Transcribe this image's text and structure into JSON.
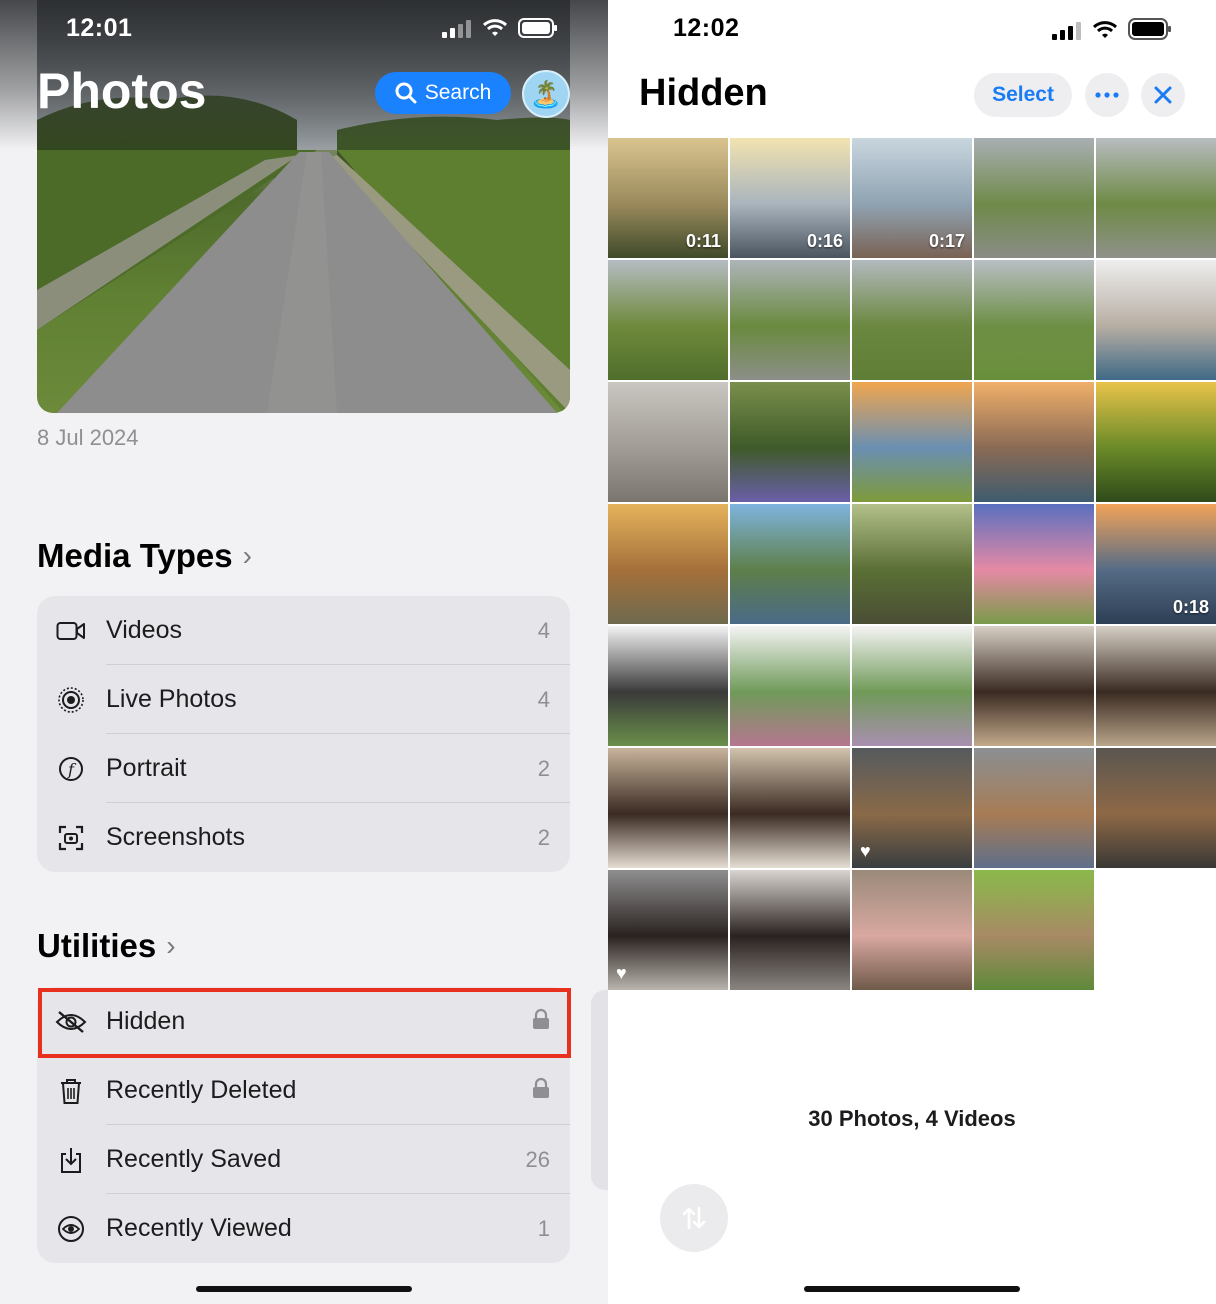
{
  "left": {
    "status_time": "12:01",
    "title": "Photos",
    "search_label": "Search",
    "avatar_emoji": "🏝️",
    "hero_date": "8 Jul 2024",
    "media_types": {
      "title": "Media Types",
      "items": [
        {
          "label": "Videos",
          "value": "4",
          "icon": "video-icon"
        },
        {
          "label": "Live Photos",
          "value": "4",
          "icon": "live-photos-icon"
        },
        {
          "label": "Portrait",
          "value": "2",
          "icon": "portrait-icon"
        },
        {
          "label": "Screenshots",
          "value": "2",
          "icon": "screenshot-icon"
        }
      ]
    },
    "utilities": {
      "title": "Utilities",
      "items": [
        {
          "label": "Hidden",
          "value": "",
          "icon": "hidden-eye-icon",
          "locked": true
        },
        {
          "label": "Recently Deleted",
          "value": "",
          "icon": "trash-icon",
          "locked": true
        },
        {
          "label": "Recently Saved",
          "value": "26",
          "icon": "download-tray-icon"
        },
        {
          "label": "Recently Viewed",
          "value": "1",
          "icon": "eye-icon"
        }
      ]
    }
  },
  "right": {
    "status_time": "12:02",
    "title": "Hidden",
    "select_label": "Select",
    "more_icon": "ellipsis-icon",
    "close_icon": "close-icon",
    "count_label": "30 Photos, 4 Videos",
    "sort_icon": "sort-arrows-icon",
    "tiles": [
      {
        "kind": "video",
        "duration": "0:11",
        "colors": [
          "#d9c48f",
          "#9a8a5c",
          "#3f4a2a"
        ]
      },
      {
        "kind": "video",
        "duration": "0:16",
        "colors": [
          "#f2e3b0",
          "#a9b4bd",
          "#4b5560"
        ]
      },
      {
        "kind": "video",
        "duration": "0:17",
        "colors": [
          "#c9d6df",
          "#8fa3b2",
          "#7a6254"
        ]
      },
      {
        "kind": "photo",
        "colors": [
          "#a9afb3",
          "#6f8a4a",
          "#8a8c86"
        ]
      },
      {
        "kind": "photo",
        "colors": [
          "#b8bcc0",
          "#6e8a45",
          "#8f918b"
        ]
      },
      {
        "kind": "photo",
        "colors": [
          "#b5bcc2",
          "#6f8a3c",
          "#4f6e2a"
        ]
      },
      {
        "kind": "photo",
        "colors": [
          "#aeb4b9",
          "#6a8a3f",
          "#8c8f88"
        ]
      },
      {
        "kind": "photo",
        "colors": [
          "#b3b9be",
          "#6b8840",
          "#5f7d35"
        ]
      },
      {
        "kind": "photo",
        "colors": [
          "#b9bfc4",
          "#6d8f45",
          "#6a8f3b"
        ]
      },
      {
        "kind": "photo",
        "colors": [
          "#eeeeee",
          "#b7aea3",
          "#3f6a86"
        ]
      },
      {
        "kind": "photo",
        "colors": [
          "#c9c6c1",
          "#a19c95",
          "#7a756e"
        ]
      },
      {
        "kind": "photo",
        "colors": [
          "#7a8f4c",
          "#3f5a2a",
          "#6a5fa8"
        ]
      },
      {
        "kind": "photo",
        "colors": [
          "#f0a64f",
          "#6a8fb1",
          "#7e9a3a"
        ]
      },
      {
        "kind": "photo",
        "colors": [
          "#f0b06a",
          "#8a6a55",
          "#3e5c6e"
        ]
      },
      {
        "kind": "photo",
        "colors": [
          "#e8c34a",
          "#6a8a28",
          "#2f4a1a"
        ]
      },
      {
        "kind": "photo",
        "colors": [
          "#e5b35c",
          "#a5703a",
          "#6f6a4e"
        ]
      },
      {
        "kind": "photo",
        "colors": [
          "#7fb4de",
          "#5e7f4a",
          "#4a6a88"
        ]
      },
      {
        "kind": "photo",
        "colors": [
          "#b3c08a",
          "#5a6f35",
          "#4a4e35"
        ]
      },
      {
        "kind": "photo",
        "colors": [
          "#5a6fbf",
          "#e58aa5",
          "#7a9a4a"
        ]
      },
      {
        "kind": "video",
        "duration": "0:18",
        "colors": [
          "#f2a35a",
          "#556b85",
          "#2d3f55"
        ]
      },
      {
        "kind": "photo",
        "colors": [
          "#f3f3f3",
          "#3a3a3a",
          "#6a8f4a"
        ]
      },
      {
        "kind": "photo",
        "colors": [
          "#f4f4f4",
          "#6f9a5a",
          "#b5778f"
        ]
      },
      {
        "kind": "photo",
        "colors": [
          "#f4f4f4",
          "#709a58",
          "#a98fb0"
        ]
      },
      {
        "kind": "photo",
        "colors": [
          "#d8d0c4",
          "#3a2a22",
          "#c2a98a"
        ]
      },
      {
        "kind": "photo",
        "colors": [
          "#d7d0c6",
          "#3a2b22",
          "#b9a58a"
        ]
      },
      {
        "kind": "photo",
        "colors": [
          "#c8b49c",
          "#3a2a22",
          "#e5dcd2"
        ]
      },
      {
        "kind": "photo",
        "colors": [
          "#d2c3ae",
          "#3a2a22",
          "#e6dfd4"
        ]
      },
      {
        "kind": "photo",
        "heart": true,
        "colors": [
          "#555a5e",
          "#8a6a48",
          "#3a3d40"
        ]
      },
      {
        "kind": "photo",
        "colors": [
          "#8b8f93",
          "#a77c55",
          "#5f6f8a"
        ]
      },
      {
        "kind": "photo",
        "colors": [
          "#5a5650",
          "#8e6846",
          "#3a3835"
        ]
      },
      {
        "kind": "photo",
        "heart": true,
        "colors": [
          "#8f8f8f",
          "#2a2220",
          "#b9b4ad"
        ]
      },
      {
        "kind": "photo",
        "colors": [
          "#d9d4cf",
          "#2a2220",
          "#8a8580"
        ]
      },
      {
        "kind": "photo",
        "colors": [
          "#9a8a7a",
          "#d9a8a0",
          "#6f5a4a"
        ]
      },
      {
        "kind": "photo",
        "colors": [
          "#8ab94a",
          "#a88a65",
          "#5f8a3a"
        ]
      }
    ]
  }
}
